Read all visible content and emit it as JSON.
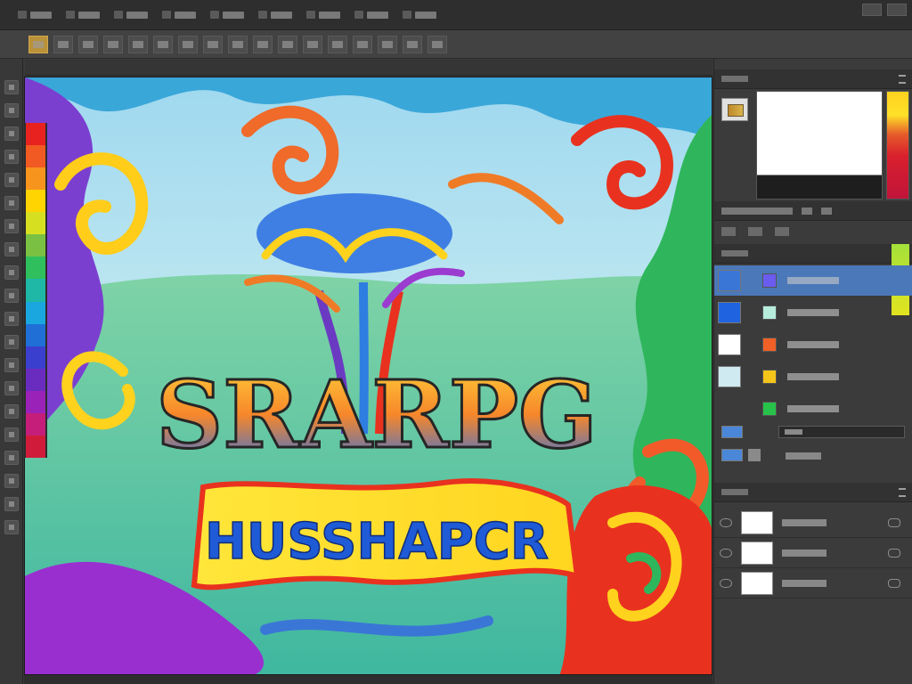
{
  "menubar": {
    "items": [
      "",
      "",
      "",
      "",
      "",
      "",
      "",
      "",
      "",
      "",
      ""
    ]
  },
  "options": {
    "items": [
      "",
      "",
      "",
      "",
      "",
      "",
      "",
      "",
      "",
      "",
      "",
      "",
      "",
      "",
      "",
      "",
      "",
      ""
    ]
  },
  "document": {
    "title": ""
  },
  "tools": {
    "icons": [
      "move-tool-icon",
      "marquee-tool-icon",
      "lasso-tool-icon",
      "quick-select-tool-icon",
      "crop-tool-icon",
      "eyedropper-tool-icon",
      "healing-tool-icon",
      "brush-tool-icon",
      "clone-stamp-tool-icon",
      "history-brush-tool-icon",
      "eraser-tool-icon",
      "gradient-tool-icon",
      "blur-tool-icon",
      "dodge-tool-icon",
      "pen-tool-icon",
      "type-tool-icon",
      "path-select-tool-icon",
      "shape-tool-icon",
      "hand-tool-icon",
      "zoom-tool-icon"
    ]
  },
  "palette": {
    "colors": [
      "#e8231f",
      "#f15a22",
      "#f7941d",
      "#ffd400",
      "#d7e020",
      "#7ac143",
      "#2fbf5d",
      "#1fb7a5",
      "#1aa7e0",
      "#1f6fd6",
      "#3b3fce",
      "#6a2bbf",
      "#9b22b8",
      "#c41e7a",
      "#d01c3a"
    ]
  },
  "canvas": {
    "title_text": "SRARPG",
    "banner_text": "HUSSHAPCR"
  },
  "panels": {
    "color": {
      "header": ""
    },
    "adjustments": {
      "tabs": [
        "",
        "",
        ""
      ]
    },
    "swatches": {
      "header": "",
      "rows": [
        {
          "name": "",
          "left": "#3a76d6",
          "small": "#6b5cf0",
          "selected": true
        },
        {
          "name": "",
          "left": "#1f63e0",
          "small": "#b7ecdd",
          "selected": false
        },
        {
          "name": "",
          "left": "#ffffff",
          "small": "#f06027",
          "selected": false
        },
        {
          "name": "",
          "left": "#cfeaf0",
          "small": "#f6c51a",
          "selected": false
        },
        {
          "name": "",
          "left": "",
          "small": "#27c24a",
          "selected": false
        }
      ]
    },
    "layer_controls": {
      "label": ""
    },
    "layers": {
      "header": "",
      "rows": [
        {
          "name": ""
        },
        {
          "name": ""
        },
        {
          "name": ""
        }
      ]
    }
  },
  "status": {
    "text": ""
  }
}
